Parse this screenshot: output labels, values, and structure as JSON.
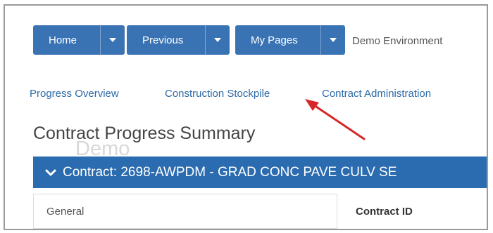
{
  "nav": {
    "buttons": [
      {
        "label": "Home"
      },
      {
        "label": "Previous"
      },
      {
        "label": "My Pages"
      }
    ],
    "environment": "Demo Environment"
  },
  "subnav": {
    "links": [
      {
        "label": "Progress Overview"
      },
      {
        "label": "Construction Stockpile"
      },
      {
        "label": "Contract Administration"
      }
    ]
  },
  "page": {
    "title": "Contract Progress Summary",
    "watermark": "Demo"
  },
  "contract": {
    "header": "Contract: 2698-AWPDM - GRAD CONC PAVE CULV SE"
  },
  "panels": {
    "general_label": "General",
    "contract_id_label": "Contract ID"
  },
  "colors": {
    "nav_button": "#3a73b4",
    "contract_bar": "#2b6bb0",
    "link": "#2d6aa8",
    "annotation_arrow": "#d62828"
  },
  "icons": {
    "dropdown": "caret-down-icon",
    "collapse": "chevron-down-icon",
    "annotation": "red-arrow-icon"
  }
}
